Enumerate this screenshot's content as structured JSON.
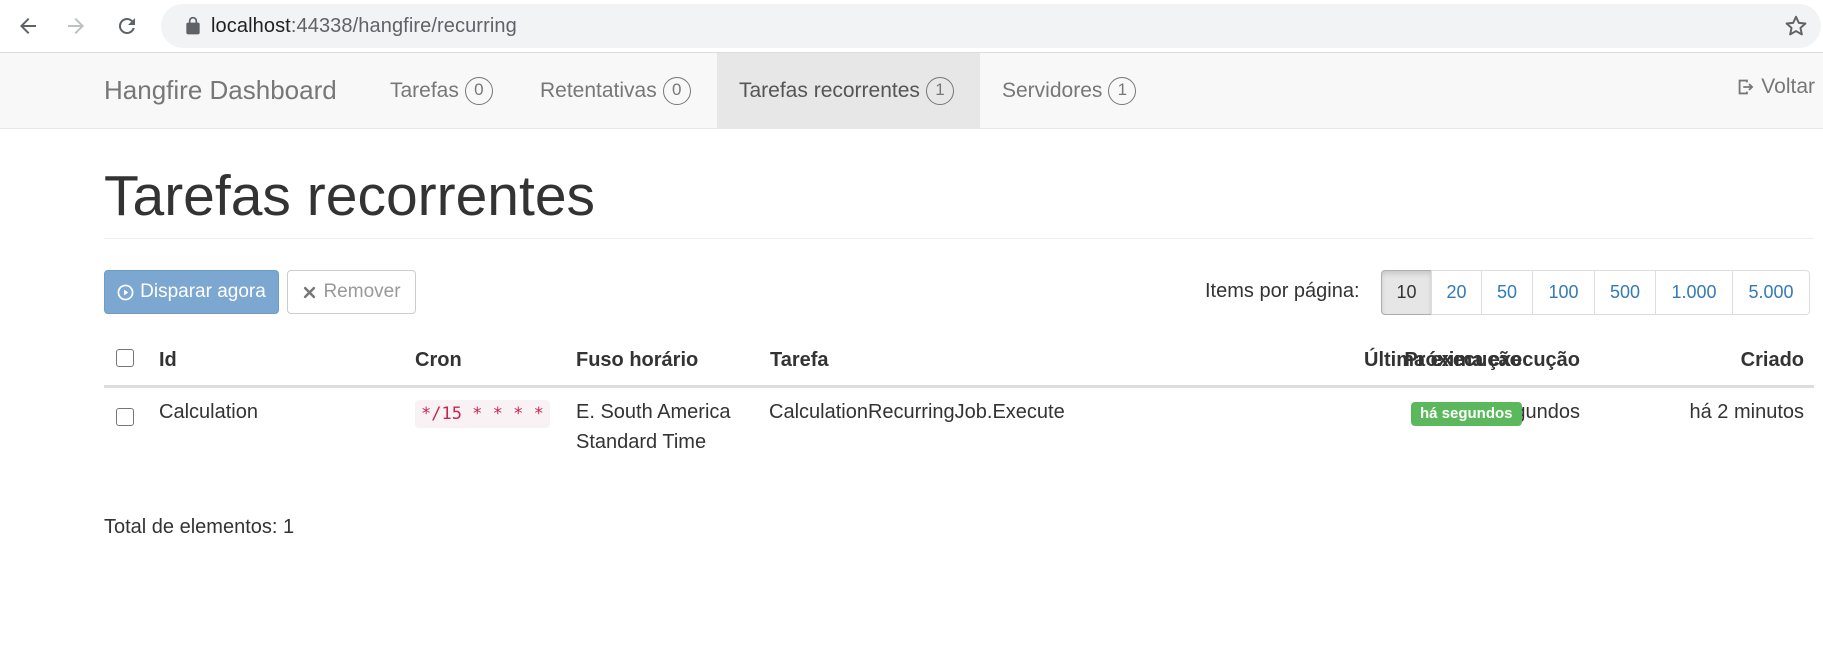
{
  "browser": {
    "url_host": "localhost",
    "url_port_path": ":44338/hangfire/recurring"
  },
  "navbar": {
    "brand": "Hangfire Dashboard",
    "items": [
      {
        "label": "Tarefas",
        "count": "0",
        "active": false
      },
      {
        "label": "Retentativas",
        "count": "0",
        "active": false
      },
      {
        "label": "Tarefas recorrentes",
        "count": "1",
        "active": true
      },
      {
        "label": "Servidores",
        "count": "1",
        "active": false
      }
    ],
    "logout_label": "Voltar"
  },
  "page": {
    "title": "Tarefas recorrentes"
  },
  "toolbar": {
    "trigger_label": "Disparar agora",
    "remove_label": "Remover",
    "per_page_label": "Items por página:",
    "per_page_options": [
      "10",
      "20",
      "50",
      "100",
      "500",
      "1.000",
      "5.000"
    ],
    "per_page_selected": "10"
  },
  "table": {
    "headers": {
      "id": "Id",
      "cron": "Cron",
      "timezone": "Fuso horário",
      "job": "Tarefa",
      "next": "Próxima execução",
      "last": "Última execução",
      "created": "Criado"
    },
    "rows": [
      {
        "id": "Calculation",
        "cron": "*/15 * * * *",
        "timezone_line1": "E. South America",
        "timezone_line2": "Standard Time",
        "job": "CalculationRecurringJob.Execute",
        "next": "em segundos",
        "last": "há segundos",
        "created": "há 2 minutos"
      }
    ]
  },
  "footer": {
    "total": "Total de elementos: 1"
  },
  "colors": {
    "primary_button": "#7ba7d0",
    "link": "#337ab7",
    "success_label": "#5cb85c",
    "cron_code": "#c7254e"
  }
}
